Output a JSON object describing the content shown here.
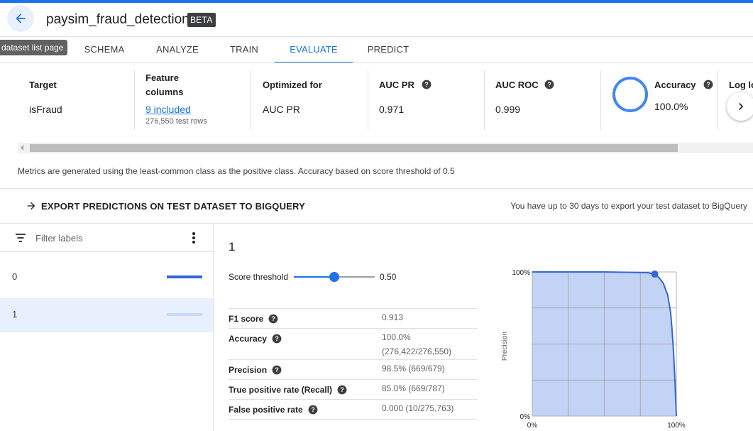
{
  "header": {
    "title": "paysim_fraud_detection",
    "badge": "BETA",
    "back_tooltip": "dataset list page"
  },
  "tabs": [
    {
      "label": "SCHEMA",
      "active": false
    },
    {
      "label": "ANALYZE",
      "active": false
    },
    {
      "label": "TRAIN",
      "active": false
    },
    {
      "label": "EVALUATE",
      "active": true
    },
    {
      "label": "PREDICT",
      "active": false
    }
  ],
  "metrics": {
    "target": {
      "label": "Target",
      "value": "isFraud"
    },
    "features": {
      "label_line1": "Feature",
      "label_line2": "columns",
      "value": "9 included",
      "sub": "276,550 test rows"
    },
    "optimized": {
      "label": "Optimized for",
      "value": "AUC PR"
    },
    "auc_pr": {
      "label": "AUC PR",
      "value": "0.971"
    },
    "auc_roc": {
      "label": "AUC ROC",
      "value": "0.999"
    },
    "accuracy": {
      "label": "Accuracy",
      "value": "100.0%"
    },
    "log_loss": {
      "label": "Log lo"
    }
  },
  "metrics_note": "Metrics are generated using the least-common class as the positive class. Accuracy based on score threshold of 0.5",
  "export": {
    "label": "EXPORT PREDICTIONS ON TEST DATASET TO BIGQUERY",
    "note": "You have up to 30 days to export your test dataset to BigQuery"
  },
  "labels_panel": {
    "filter_placeholder": "Filter labels",
    "items": [
      {
        "name": "0",
        "selected": false,
        "bar_color": "#3367d6"
      },
      {
        "name": "1",
        "selected": true,
        "bar_color": "#c6dafc"
      }
    ]
  },
  "detail": {
    "title": "1",
    "threshold_label": "Score threshold",
    "threshold_value": "0.50",
    "threshold": 0.5,
    "stats": [
      {
        "label": "F1 score",
        "value": "0.913"
      },
      {
        "label": "Accuracy",
        "value": "100.0%",
        "value2": "(276,422/276,550)"
      },
      {
        "label": "Precision",
        "value": "98.5% (669/679)"
      },
      {
        "label": "True positive rate (Recall)",
        "value": "85.0% (669/787)"
      },
      {
        "label": "False positive rate",
        "value": "0.000 (10/275,763)"
      }
    ]
  },
  "chart_data": {
    "type": "area",
    "ylabel": "Precision",
    "xlabel": "",
    "x_ticks": [
      "0%",
      "100%"
    ],
    "y_ticks": [
      "0%",
      "100%"
    ],
    "xlim": [
      0,
      1
    ],
    "ylim": [
      0,
      1
    ],
    "grid": true,
    "series": [
      {
        "x": [
          0,
          0.5,
          0.8,
          0.85,
          0.88,
          0.91,
          0.94,
          0.96,
          0.97,
          0.98,
          0.99,
          1.0
        ],
        "y": [
          1.0,
          1.0,
          0.995,
          0.985,
          0.96,
          0.92,
          0.84,
          0.72,
          0.6,
          0.45,
          0.25,
          0.0
        ]
      }
    ],
    "marker": {
      "x": 0.85,
      "y": 0.985
    },
    "colors": {
      "fill": "#c3d3f5",
      "line": "#3367d6",
      "grid": "#9e9e9e"
    }
  },
  "colors": {
    "accent": "#1a73e8"
  }
}
